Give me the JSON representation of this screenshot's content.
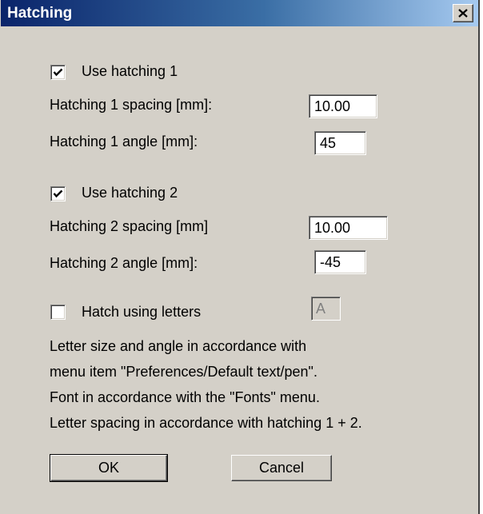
{
  "window": {
    "title": "Hatching"
  },
  "hatching1": {
    "use_label": "Use hatching 1",
    "use_checked": true,
    "spacing_label": "Hatching 1 spacing [mm]:",
    "spacing_value": "10.00",
    "angle_label": "Hatching 1 angle [mm]:",
    "angle_value": "45"
  },
  "hatching2": {
    "use_label": "Use hatching 2",
    "use_checked": true,
    "spacing_label": "Hatching 2 spacing [mm]",
    "spacing_value": "10.00",
    "angle_label": "Hatching 2 angle [mm]:",
    "angle_value": "-45"
  },
  "letters": {
    "use_label": "Hatch using letters",
    "use_checked": false,
    "letter_value": "A"
  },
  "info_lines": [
    "Letter size and angle in accordance with",
    "menu item \"Preferences/Default text/pen\".",
    "Font in accordance with the \"Fonts\" menu.",
    "Letter spacing in accordance with hatching 1 + 2."
  ],
  "buttons": {
    "ok": "OK",
    "cancel": "Cancel"
  }
}
